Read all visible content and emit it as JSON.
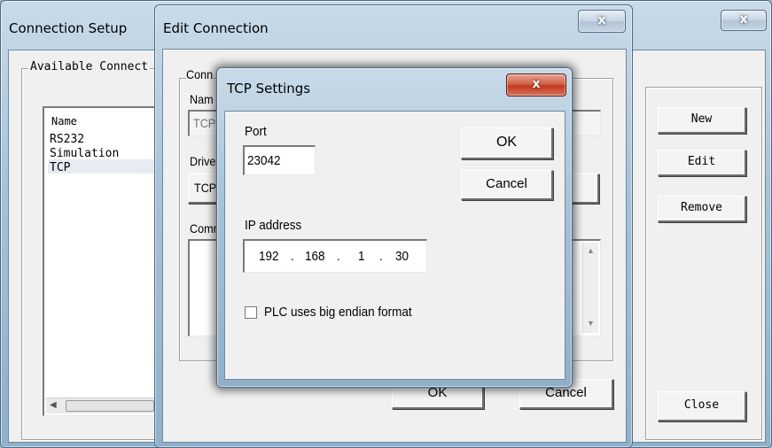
{
  "connection_setup": {
    "title": "Connection Setup",
    "close_glyph": "x",
    "group_label": "Available Connect",
    "list_header": "Name",
    "items": [
      "RS232",
      "Simulation",
      "TCP"
    ],
    "buttons": {
      "new": "New",
      "edit": "Edit",
      "remove": "Remove",
      "close": "Close"
    }
  },
  "edit_connection": {
    "title": "Edit Connection",
    "close_glyph": "x",
    "connection_group_label": "Conn",
    "name_label": "Nam",
    "name_value": "TCP",
    "driver_label": "Drive",
    "driver_value": "TCP",
    "comment_label": "Comm",
    "ok_label": "OK",
    "cancel_label": "Cancel"
  },
  "tcp_settings": {
    "title": "TCP Settings",
    "close_glyph": "x",
    "port_label": "Port",
    "port_value": "23042",
    "ip_label": "IP address",
    "ip_octets": [
      "192",
      "168",
      "1",
      "30"
    ],
    "ip_dot": ".",
    "big_endian_label": "PLC uses big endian format",
    "big_endian_checked": false,
    "ok_label": "OK",
    "cancel_label": "Cancel"
  },
  "colors": {
    "close_red": "#c1391f",
    "aero_blue": "#a9c3d8",
    "dialog_face": "#f0f0f0"
  }
}
